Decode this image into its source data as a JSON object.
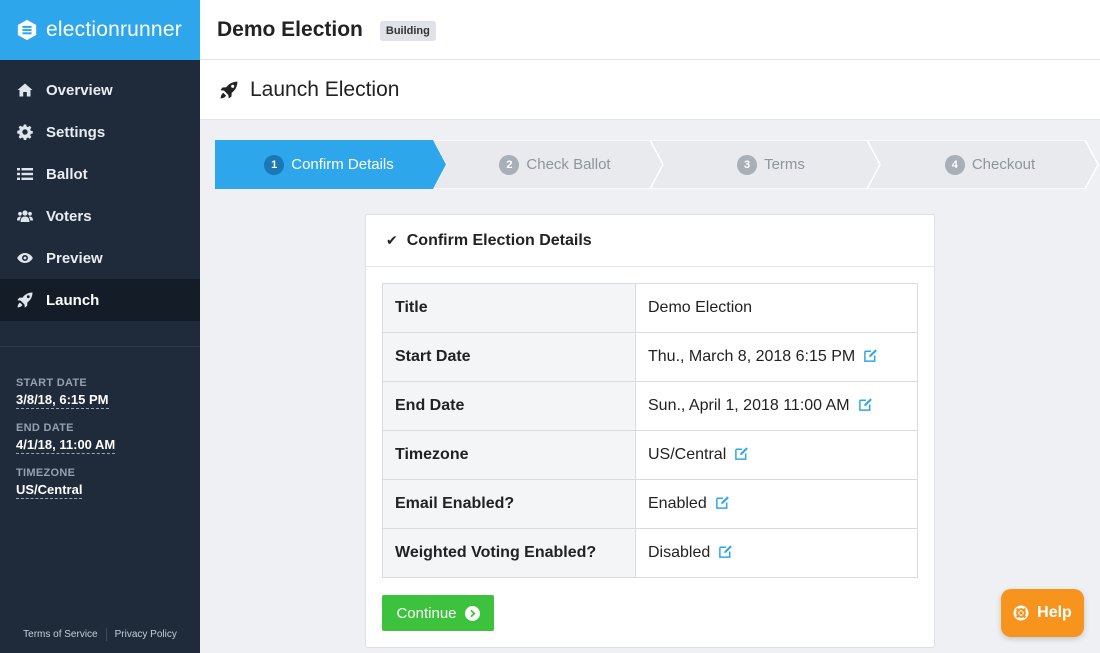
{
  "brand": {
    "name": "electionrunner"
  },
  "header": {
    "election_title": "Demo Election",
    "status_badge": "Building"
  },
  "page": {
    "title": "Launch Election"
  },
  "sidebar": {
    "items": [
      {
        "label": "Overview",
        "icon": "home-icon"
      },
      {
        "label": "Settings",
        "icon": "gear-icon"
      },
      {
        "label": "Ballot",
        "icon": "list-icon"
      },
      {
        "label": "Voters",
        "icon": "users-icon"
      },
      {
        "label": "Preview",
        "icon": "eye-icon"
      },
      {
        "label": "Launch",
        "icon": "rocket-icon",
        "active": true
      }
    ],
    "meta": {
      "start_label": "START DATE",
      "start_value": "3/8/18, 6:15 PM",
      "end_label": "END DATE",
      "end_value": "4/1/18, 11:00 AM",
      "tz_label": "TIMEZONE",
      "tz_value": "US/Central"
    },
    "footer": {
      "terms": "Terms of Service",
      "privacy": "Privacy Policy"
    }
  },
  "steps": [
    {
      "num": "1",
      "label": "Confirm Details",
      "active": true
    },
    {
      "num": "2",
      "label": "Check Ballot"
    },
    {
      "num": "3",
      "label": "Terms"
    },
    {
      "num": "4",
      "label": "Checkout"
    }
  ],
  "card": {
    "title": "Confirm Election Details",
    "rows": [
      {
        "key": "Title",
        "value": "Demo Election",
        "editable": false
      },
      {
        "key": "Start Date",
        "value": "Thu., March 8, 2018 6:15 PM",
        "editable": true
      },
      {
        "key": "End Date",
        "value": "Sun., April 1, 2018 11:00 AM",
        "editable": true
      },
      {
        "key": "Timezone",
        "value": "US/Central",
        "editable": true
      },
      {
        "key": "Email Enabled?",
        "value": "Enabled",
        "editable": true
      },
      {
        "key": "Weighted Voting Enabled?",
        "value": "Disabled",
        "editable": true
      }
    ],
    "continue_label": "Continue"
  },
  "help": {
    "label": "Help"
  },
  "colors": {
    "brand": "#2ea6ec",
    "sidebar": "#1f2a3a",
    "continue": "#3cc23c",
    "help": "#f7941e",
    "active_step": "#2ea6ec"
  }
}
